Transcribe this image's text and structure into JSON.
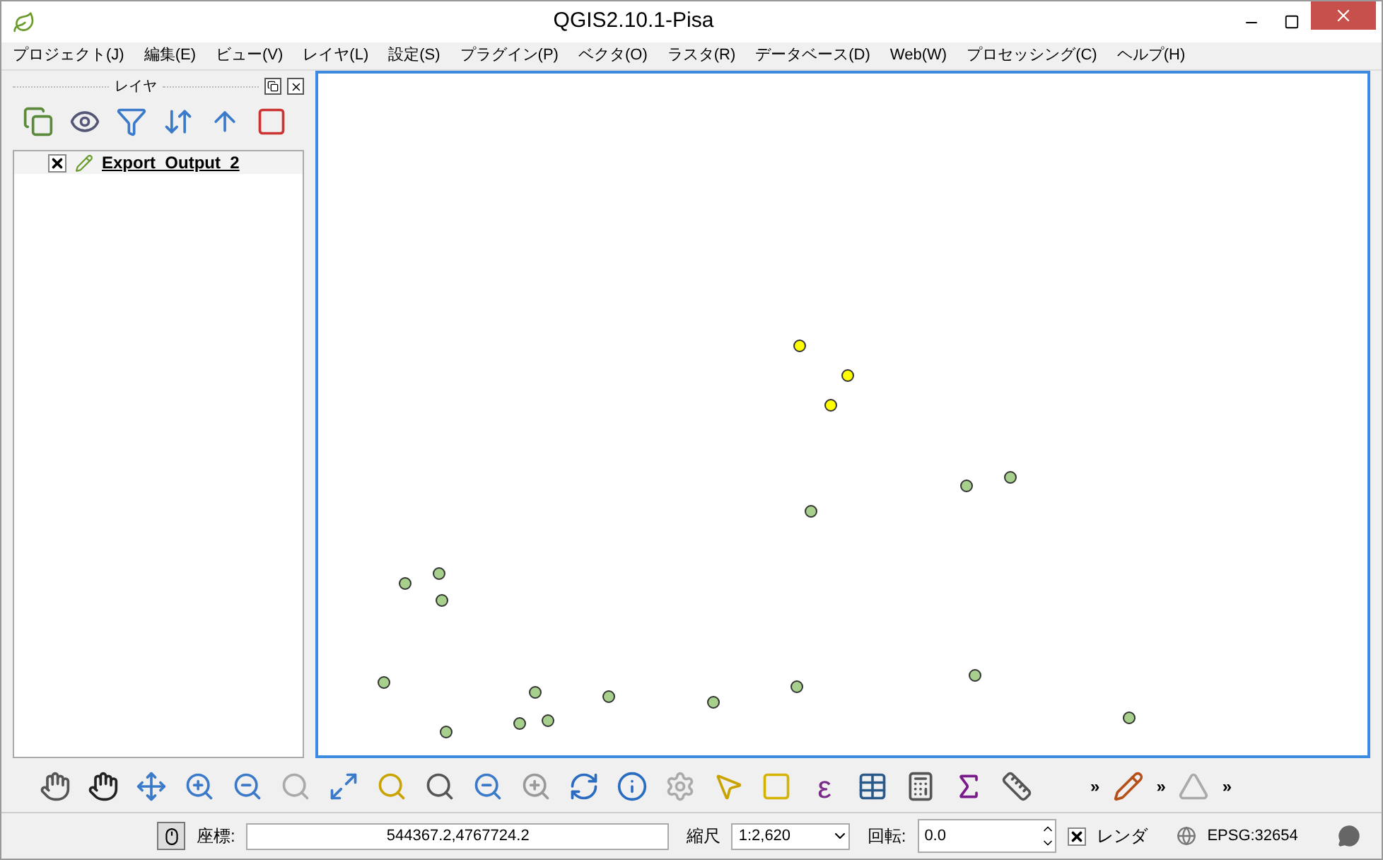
{
  "window": {
    "title": "QGIS2.10.1-Pisa"
  },
  "menu": [
    "プロジェクト(J)",
    "編集(E)",
    "ビュー(V)",
    "レイヤ(L)",
    "設定(S)",
    "プラグイン(P)",
    "ベクタ(O)",
    "ラスタ(R)",
    "データベース(D)",
    "Web(W)",
    "プロセッシング(C)",
    "ヘルプ(H)"
  ],
  "layers_panel": {
    "title": "レイヤ",
    "layers": [
      {
        "name": "Export_Output_2",
        "checked": true
      }
    ]
  },
  "map": {
    "features": [
      {
        "selected": true
      },
      {
        "selected": true
      },
      {
        "selected": true
      },
      {
        "selected": false
      },
      {
        "selected": false
      },
      {
        "selected": false
      },
      {
        "selected": false
      },
      {
        "selected": false
      },
      {
        "selected": false
      },
      {
        "selected": false
      },
      {
        "selected": false
      },
      {
        "selected": false
      },
      {
        "selected": false
      },
      {
        "selected": false
      },
      {
        "selected": false
      },
      {
        "selected": false
      },
      {
        "selected": false
      },
      {
        "selected": false
      },
      {
        "selected": false
      }
    ]
  },
  "toolbar": {
    "expression_symbol": "ε",
    "overflow": [
      "»",
      "»",
      "»"
    ]
  },
  "status_bar": {
    "coordinate_label": "座標:",
    "coordinate": "544367.2,4767724.2",
    "scale_label": "縮尺",
    "scale": "1:2,620",
    "rotation_label": "回転:",
    "rotation": "0.0",
    "render_label": "レンダ",
    "render": true,
    "crs": "EPSG:32654"
  }
}
